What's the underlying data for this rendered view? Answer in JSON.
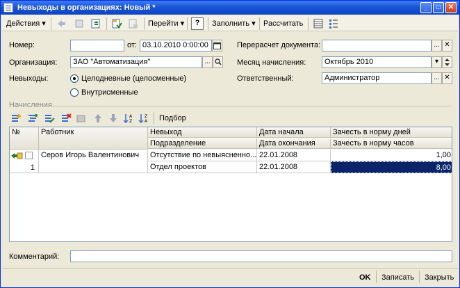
{
  "window": {
    "title": "Невыходы в организациях: Новый *",
    "minimize_glyph": "_",
    "maximize_glyph": "□",
    "close_glyph": "✕"
  },
  "toolbar": {
    "actions_label": "Действия",
    "goto_label": "Перейти",
    "help_label": "?",
    "fill_label": "Заполнить",
    "calculate_label": "Рассчитать"
  },
  "form": {
    "number_label": "Номер:",
    "number_value": "",
    "date_from_label": "от:",
    "date_value": "03.10.2010  0:00:00",
    "org_label": "Организация:",
    "org_value": "ЗАО \"Автоматизация\"",
    "absences_label": "Невыходы:",
    "radio_fullday_label": "Целодневные (целосменные)",
    "radio_intrashift_label": "Внутрисменные",
    "recalc_label": "Перерасчет документа:",
    "recalc_value": "",
    "month_label": "Месяц начисления:",
    "month_value": "Октябрь 2010",
    "responsible_label": "Ответственный:",
    "responsible_value": "Администратор",
    "comment_label": "Комментарий:",
    "comment_value": ""
  },
  "accruals": {
    "section_title": "Начисления",
    "selection_label": "Подбор",
    "columns": {
      "num": "№",
      "worker": "Работник",
      "absence": "Невыход",
      "department": "Подразделение",
      "date_start": "Дата начала",
      "date_end": "Дата окончания",
      "norm_days": "Зачесть в норму дней",
      "norm_hours": "Зачесть в норму часов"
    },
    "rows": [
      {
        "num": "1",
        "worker": "Серов Игорь Валентинович",
        "absence": "Отсутствие по невыясненно...",
        "department": "Отдел проектов",
        "date_start": "22.01.2008",
        "date_end": "22.01.2008",
        "norm_days": "1,00",
        "norm_hours": "8,00"
      }
    ]
  },
  "footer": {
    "ok_label": "OK",
    "save_label": "Записать",
    "close_label": "Закрыть"
  }
}
